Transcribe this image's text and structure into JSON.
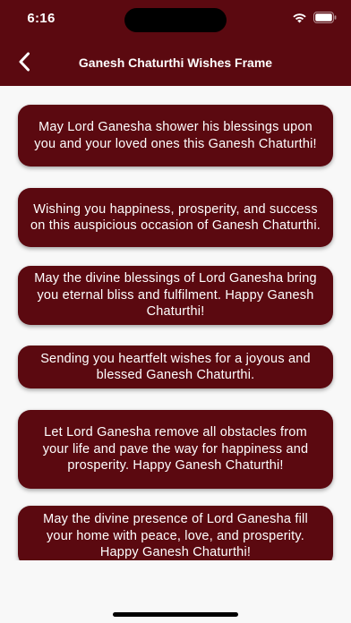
{
  "status_bar": {
    "time": "6:16",
    "icons": [
      "wifi-icon",
      "battery-icon"
    ]
  },
  "header": {
    "title": "Ganesh Chaturthi Wishes Frame",
    "back_icon": "chevron-left-icon"
  },
  "colors": {
    "primary": "#5b0910",
    "background": "#f8f8f8",
    "text_on_primary": "#ffffff"
  },
  "wishes": [
    "May Lord Ganesha shower his blessings upon you and your loved ones this Ganesh Chaturthi!",
    "Wishing you happiness, prosperity, and success on this auspicious occasion of Ganesh Chaturthi.",
    "May the divine blessings of Lord Ganesha bring you eternal bliss and fulfilment. Happy Ganesh Chaturthi!",
    "Sending you heartfelt wishes for a joyous and blessed Ganesh Chaturthi.",
    "Let Lord Ganesha remove all obstacles from your life and pave the way for happiness and prosperity. Happy Ganesh Chaturthi!",
    "May the divine presence of Lord Ganesha fill your home with peace, love, and prosperity. Happy Ganesh Chaturthi!"
  ]
}
